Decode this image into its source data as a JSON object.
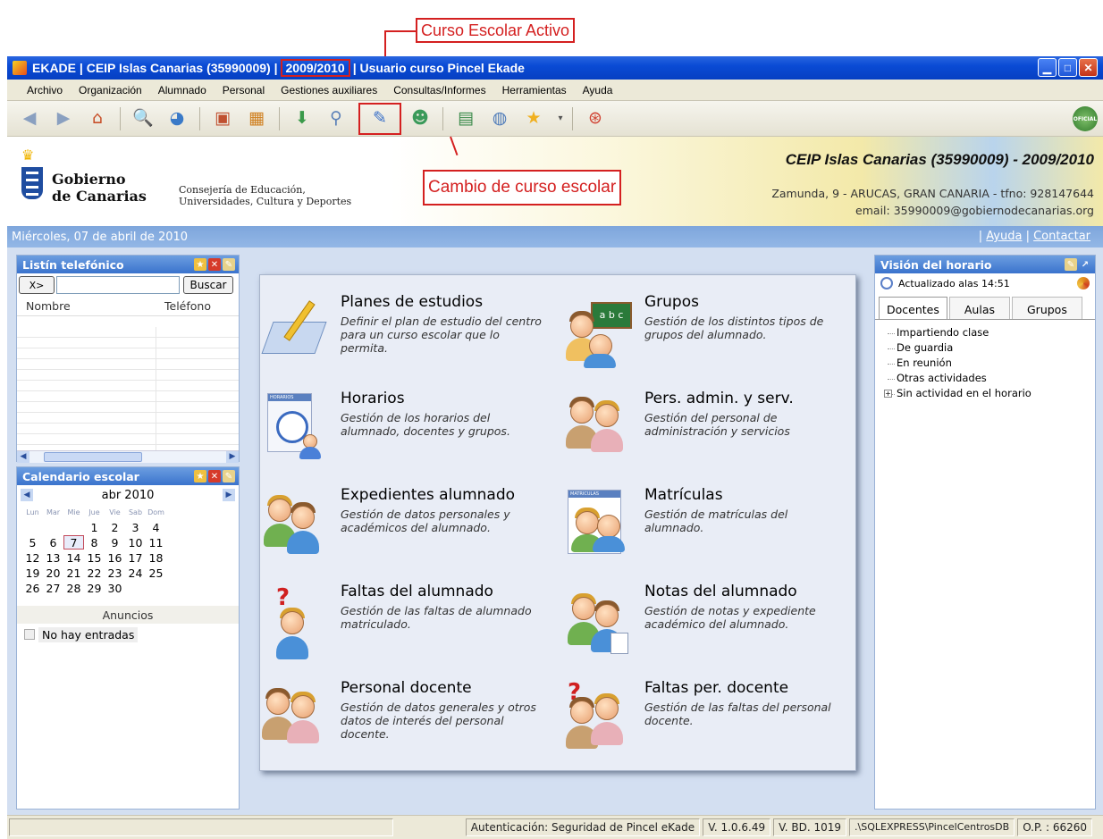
{
  "callouts": {
    "active_year": "Curso Escolar Activo",
    "change_year": "Cambio de curso escolar"
  },
  "window": {
    "title_prefix": "EKADE | CEIP Islas Canarias  (35990009)  |",
    "title_year": "2009/2010",
    "title_suffix": "| Usuario curso Pincel Ekade"
  },
  "menu": [
    "Archivo",
    "Organización",
    "Alumnado",
    "Personal",
    "Gestiones auxiliares",
    "Consultas/Informes",
    "Herramientas",
    "Ayuda"
  ],
  "toolbar": {
    "icons": [
      "back-icon",
      "forward-icon",
      "home-icon",
      "search-report-icon",
      "chart-icon",
      "calendar-3-icon",
      "schedule-grid-icon",
      "download-icon",
      "network-icon",
      "course-change-icon",
      "users-icon",
      "book-icon",
      "globe-icon",
      "favorites-star-icon",
      "help-lifebuoy-icon"
    ],
    "official_badge": "OFICIAL"
  },
  "banner": {
    "gov_name_1": "Gobierno",
    "gov_name_2": "de Canarias",
    "consejeria_1": "Consejería de Educación,",
    "consejeria_2": "Universidades, Cultura y Deportes",
    "center_name": "CEIP Islas Canarias (35990009) - 2009/2010",
    "center_address": "Zamunda, 9 - ARUCAS, GRAN CANARIA - tfno: 928147644",
    "center_email": "email: 35990009@gobiernodecanarias.org"
  },
  "datestrip": {
    "date": "Miércoles, 07 de abril de 2010",
    "help": "Ayuda",
    "contact": "Contactar"
  },
  "listin": {
    "title": "Listín telefónico",
    "clear_button": "X>",
    "search_placeholder": "",
    "search_button": "Buscar",
    "col_name": "Nombre",
    "col_phone": "Teléfono"
  },
  "calendar": {
    "title": "Calendario escolar",
    "month": "abr 2010",
    "weekdays": [
      "Lun",
      "Mar",
      "Mie",
      "Jue",
      "Vie",
      "Sab",
      "Dom"
    ],
    "today": "7",
    "anuncios": "Anuncios",
    "no_entries": "No hay entradas"
  },
  "tiles": [
    {
      "title": "Planes de estudios",
      "desc": "Definir el plan de estudio del centro para un curso escolar que lo permita."
    },
    {
      "title": "Grupos",
      "desc": "Gestión de los distintos tipos de grupos del alumnado."
    },
    {
      "title": "Horarios",
      "desc": "Gestión de los horarios del alumnado, docentes y grupos."
    },
    {
      "title": "Pers. admin. y serv.",
      "desc": "Gestión del personal de administración y servicios"
    },
    {
      "title": "Expedientes alumnado",
      "desc": "Gestión de datos personales y académicos del alumnado."
    },
    {
      "title": "Matrículas",
      "desc": "Gestión de matrículas del alumnado."
    },
    {
      "title": "Faltas del alumnado",
      "desc": "Gestión de las faltas de alumnado matriculado."
    },
    {
      "title": "Notas del alumnado",
      "desc": "Gestión de notas y expediente académico del alumnado."
    },
    {
      "title": "Personal docente",
      "desc": "Gestión de datos generales y otros datos de interés del personal docente."
    },
    {
      "title": "Faltas per. docente",
      "desc": "Gestión de las faltas del personal docente."
    }
  ],
  "icon_labels": {
    "grupos_board": "a b c",
    "matriculas_sheet": "MATRICULAS",
    "horarios_sheet": "HORARIOS",
    "question_mark": "?"
  },
  "vision": {
    "title": "Visión del horario",
    "updated": "Actualizado alas 14:51",
    "tabs": [
      "Docentes",
      "Aulas",
      "Grupos"
    ],
    "tree": [
      "Impartiendo clase",
      "De guardia",
      "En reunión",
      "Otras actividades",
      "Sin actividad en el horario"
    ]
  },
  "status": {
    "auth": "Autenticación: Seguridad de Pincel eKade",
    "version": "V. 1.0.6.49",
    "db_version": "V. BD. 1019",
    "server": ".\\SQLEXPRESS\\PincelCentrosDB",
    "op": "O.P. : 66260"
  }
}
